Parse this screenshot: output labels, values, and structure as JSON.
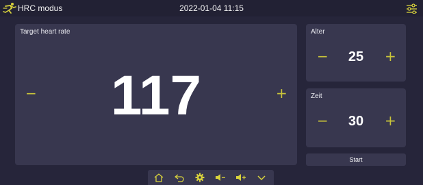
{
  "header": {
    "app_title": "HRC modus",
    "datetime": "2022-01-04 11:15",
    "icons": {
      "logo": "runner-logo",
      "settings": "sliders-icon"
    }
  },
  "heart_rate": {
    "label": "Target heart rate",
    "value": "117",
    "minus": "−",
    "plus": "+"
  },
  "alter": {
    "label": "Alter",
    "value": "25",
    "minus": "−",
    "plus": "+"
  },
  "zeit": {
    "label": "Zeit",
    "value": "30",
    "minus": "−",
    "plus": "+"
  },
  "start_label": "Start",
  "bottom_nav": [
    "home-icon",
    "back-icon",
    "settings-gear-icon",
    "volume-down-icon",
    "volume-up-icon",
    "chevron-down-icon"
  ],
  "colors": {
    "accent": "#c9c43a",
    "background": "#26253a",
    "panel": "#38374f"
  }
}
